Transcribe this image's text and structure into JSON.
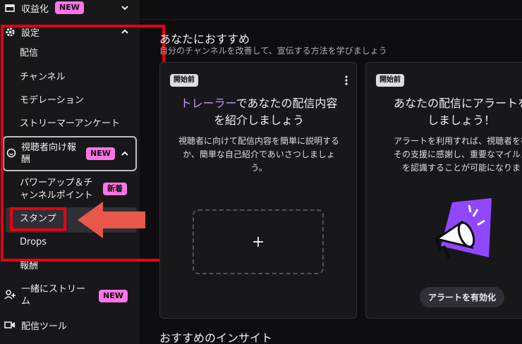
{
  "sidebar": {
    "monetization": {
      "label": "収益化",
      "badge": "NEW"
    },
    "settings": {
      "label": "設定"
    },
    "settings_items": [
      "配信",
      "チャンネル",
      "モデレーション",
      "ストリーマーアンケート"
    ],
    "viewer_rewards": {
      "label_line1": "視聴者向け報",
      "label_line2": "酬",
      "badge": "NEW"
    },
    "power_ups": {
      "label_line1": "パワーアップ＆チ",
      "label_line2": "ャンネルポイント",
      "badge": "新着"
    },
    "emotes": {
      "label": "スタンプ"
    },
    "drops": {
      "label": "Drops"
    },
    "rewards": {
      "label": "報酬"
    },
    "stream_together": {
      "label_line1": "一緒にストリー",
      "label_line2": "ム",
      "badge": "NEW"
    },
    "streaming_tools": {
      "label": "配信ツール"
    }
  },
  "main": {
    "section_title": "あなたにおすすめ",
    "section_subtitle": "自分のチャンネルを改善して、宣伝する方法を学びましょう",
    "card1": {
      "status": "開始前",
      "title_accent": "トレーラー",
      "title_rest": "であなたの配信内容",
      "title_line2": "を紹介しましょう",
      "desc_line1": "視聴者に向けて配信内容を簡単に説明する",
      "desc_line2": "か、簡単な自己紹介であいさつしましょ",
      "desc_line3": "う。",
      "add_symbol": "+"
    },
    "card2": {
      "status": "開始前",
      "title_line1": "あなたの配信にアラートを",
      "title_line2": "しましょう！",
      "desc_line1": "アラートを利用すれば、視聴者を祝",
      "desc_line2": "その支援に感謝し、重要なマイルス",
      "desc_line3": "を認識することが可能になりま",
      "button": "アラートを有効化"
    },
    "insights_title": "おすすめのインサイト"
  },
  "colors": {
    "accent": "#bf94ff",
    "badge": "#ff75e6",
    "highlight_red": "#e60012",
    "arrow": "#e8574a"
  }
}
